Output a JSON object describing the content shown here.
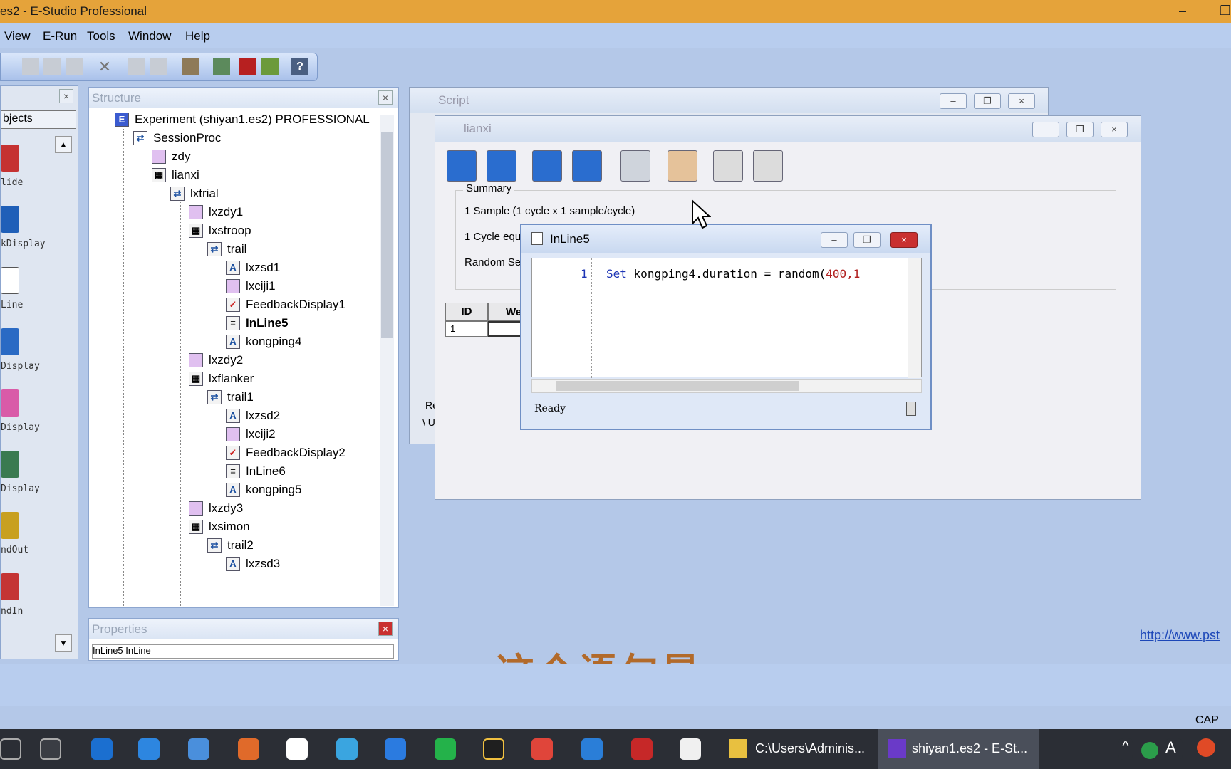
{
  "title": "es2 - E-Studio Professional",
  "menu": [
    "View",
    "E-Run",
    "Tools",
    "Window",
    "Help"
  ],
  "toolbox": {
    "search_label": "bjects",
    "items": [
      "lide",
      "kDisplay",
      "Line",
      "Display",
      "Display",
      "Display",
      "ndOut",
      "ndIn"
    ]
  },
  "structure": {
    "title": "Structure",
    "items": [
      "Experiment (shiyan1.es2) PROFESSIONAL",
      "SessionProc",
      "zdy",
      "lianxi",
      "lxtrial",
      "lxzdy1",
      "lxstroop",
      "trail",
      "lxzsd1",
      "lxciji1",
      "FeedbackDisplay1",
      "InLine5",
      "kongping4",
      "lxzdy2",
      "lxflanker",
      "trail1",
      "lxzsd2",
      "lxciji2",
      "FeedbackDisplay2",
      "InLine6",
      "kongping5",
      "lxzdy3",
      "lxsimon",
      "trail2",
      "lxzsd3"
    ]
  },
  "properties": {
    "title": "Properties",
    "value": "InLine5 InLine"
  },
  "script_window": {
    "title": "Script",
    "line_a": "Re",
    "line_b": "\\ U"
  },
  "lianxi_window": {
    "title": "lianxi",
    "summary_label": "Summary",
    "summary_lines": [
      "1 Sample (1 cycle x 1 sample/cycle)",
      "1 Cycle equ",
      "Random Se"
    ],
    "grid_headers": [
      "ID",
      "We"
    ],
    "grid_row": "1"
  },
  "inline_window": {
    "title": "InLine5",
    "line_number": "1",
    "code_keyword": "Set",
    "code_body": "kongping4.duration = random(",
    "code_num": "400,1",
    "status": "Ready"
  },
  "url_text": "http://www.pst",
  "subtitle": "这个语句是",
  "statusbar": {
    "right_text": "CAP"
  },
  "taskbar": {
    "items": [
      "C:\\Users\\Adminis...",
      "shiyan1.es2 - E-St..."
    ]
  }
}
